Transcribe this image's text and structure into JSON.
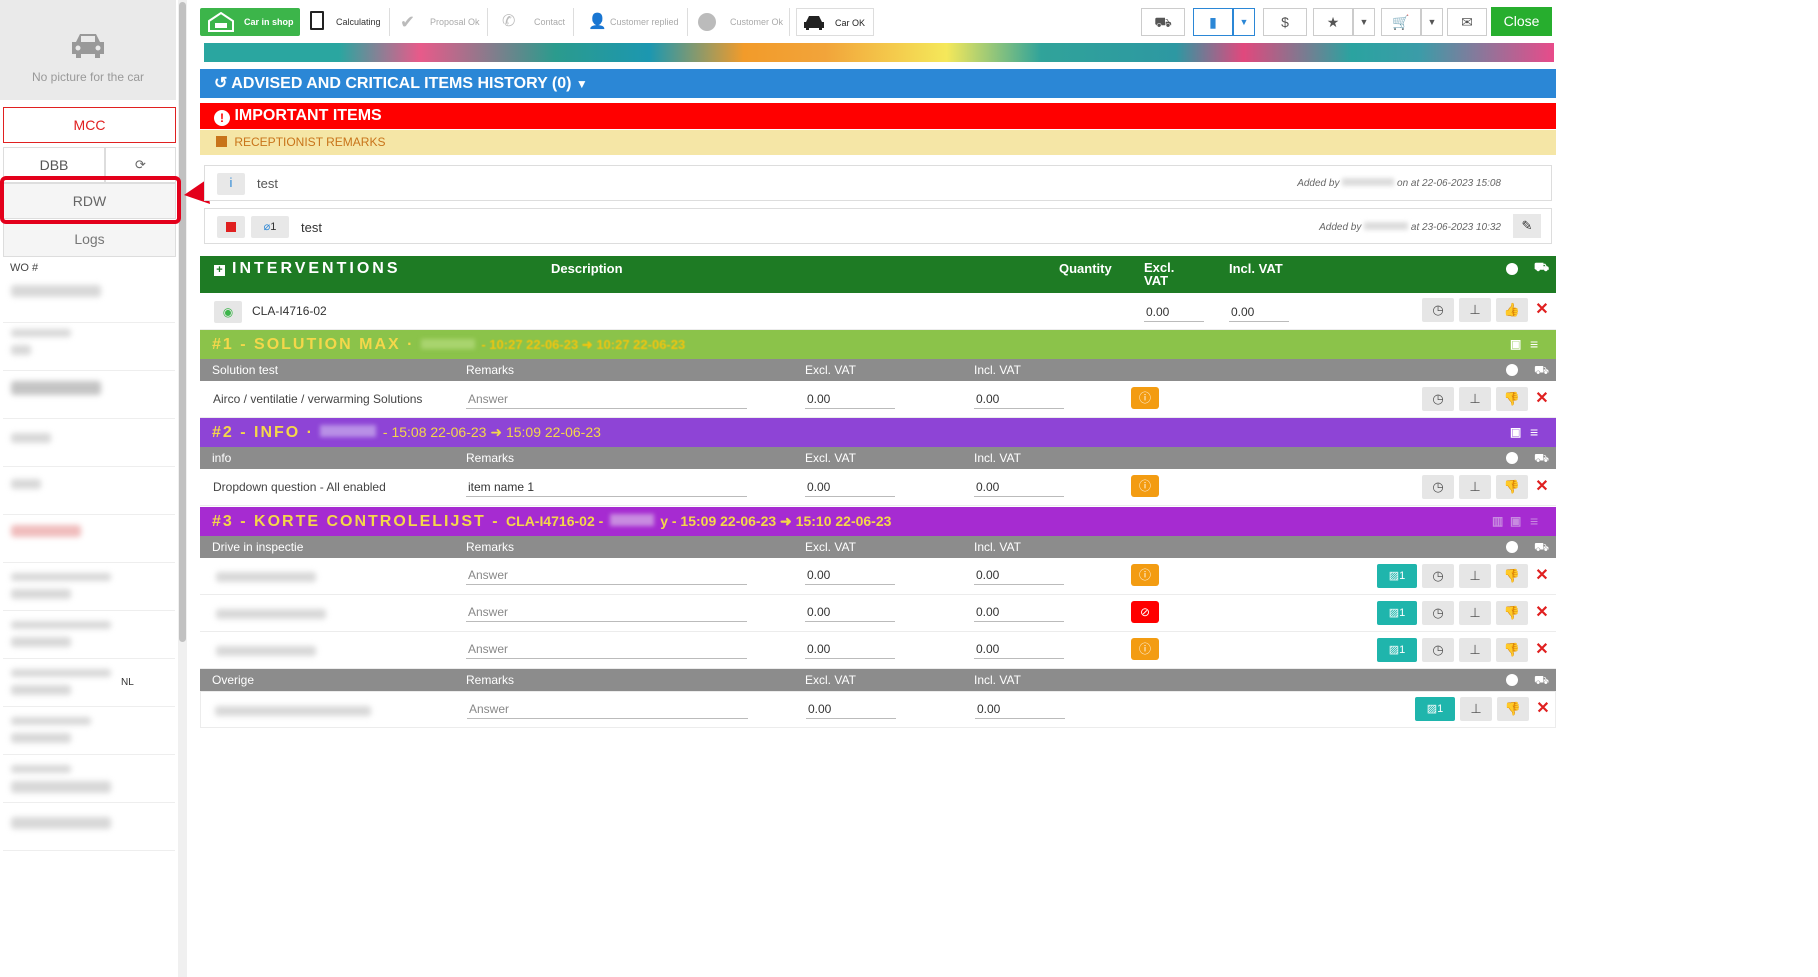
{
  "sidebar": {
    "no_picture": "No picture for the car",
    "mcc": "MCC",
    "dbb": "DBB",
    "rdw": "RDW",
    "logs": "Logs",
    "wo_label": "WO #",
    "nl_text": "NL"
  },
  "steps": [
    {
      "label": "Car in shop"
    },
    {
      "label": "Calculating"
    },
    {
      "label": "Proposal Ok"
    },
    {
      "label": "Contact"
    },
    {
      "label": "Customer replied"
    },
    {
      "label": "Customer Ok"
    },
    {
      "label": "Car OK"
    }
  ],
  "toolbar": {
    "dollar": "$",
    "close": "Close"
  },
  "history": {
    "title": "ADVISED AND CRITICAL ITEMS HISTORY (0)"
  },
  "important": {
    "title": "IMPORTANT ITEMS"
  },
  "remarks": {
    "title": "RECEPTIONIST REMARKS",
    "items": [
      {
        "text": "test",
        "added_prefix": "Added by",
        "added_suffix": "on at 22-06-2023 15:08"
      },
      {
        "text": "test",
        "attach_count": "1",
        "added_prefix": "Added by",
        "added_suffix": "at 23-06-2023 10:32"
      }
    ]
  },
  "interventions": {
    "title": "INTERVENTIONS",
    "col_description": "Description",
    "col_quantity": "Quantity",
    "col_excl": "Excl. VAT",
    "col_incl": "Incl. VAT",
    "row": {
      "code": "CLA-I4716-02",
      "excl": "0.00",
      "incl": "0.00"
    }
  },
  "sections": [
    {
      "title": "#1 - SOLUTION MAX ·",
      "time": "- 10:27 22-06-23 ➜ 10:27 22-06-23",
      "sub": {
        "name": "Solution test",
        "remarks": "Remarks",
        "excl": "Excl. VAT",
        "incl": "Incl. VAT"
      },
      "rows": [
        {
          "label": "Airco / ventilatie / verwarming Solutions",
          "remark": "Answer",
          "excl": "0.00",
          "incl": "0.00"
        }
      ]
    },
    {
      "title": "#2 - INFO ·",
      "time": "- 15:08 22-06-23 ➜ 15:09 22-06-23",
      "sub": {
        "name": "info",
        "remarks": "Remarks",
        "excl": "Excl. VAT",
        "incl": "Incl. VAT"
      },
      "rows": [
        {
          "label": "Dropdown question - All enabled",
          "remark": "item name 1",
          "excl": "0.00",
          "incl": "0.00"
        }
      ]
    },
    {
      "title": "#3 - KORTE CONTROLELIJST -",
      "code": "CLA-I4716-02 -",
      "time": "y - 15:09 22-06-23 ➜ 15:10 22-06-23",
      "sub": {
        "name": "Drive in inspectie",
        "remarks": "Remarks",
        "excl": "Excl. VAT",
        "incl": "Incl. VAT"
      },
      "rows": [
        {
          "remark": "Answer",
          "excl": "0.00",
          "incl": "0.00",
          "photos": "1"
        },
        {
          "remark": "Answer",
          "excl": "0.00",
          "incl": "0.00",
          "photos": "1"
        },
        {
          "remark": "Answer",
          "excl": "0.00",
          "incl": "0.00",
          "photos": "1"
        }
      ],
      "sub2": {
        "name": "Overige",
        "remarks": "Remarks",
        "excl": "Excl. VAT",
        "incl": "Incl. VAT"
      },
      "rows2": [
        {
          "remark": "Answer",
          "excl": "0.00",
          "incl": "0.00",
          "photos": "1"
        }
      ]
    }
  ],
  "colors": {
    "green": "#3cb54a",
    "blue": "#2b87d6",
    "red": "#ff0000",
    "dark_green": "#1e7b24",
    "lime": "#8bc34a",
    "purple": "#8e44d6",
    "magenta": "#a62bd1",
    "orange": "#f39c12",
    "teal": "#1fb5ac"
  }
}
